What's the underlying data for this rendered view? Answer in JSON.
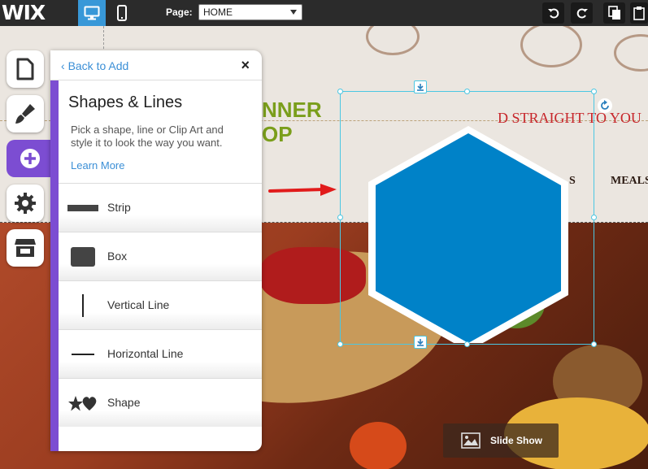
{
  "topbar": {
    "logo": "WIX",
    "page_label": "Page:",
    "page_select": "HOME"
  },
  "site": {
    "title_line1": "NNER",
    "title_line2": "OP",
    "tagline": "D STRAIGHT TO YOU",
    "nav": [
      "S",
      "MEALS"
    ],
    "slideshow_label": "Slide Show",
    "hexagon_color": "#0082c8"
  },
  "panel": {
    "back_label": "Back to Add",
    "close_label": "×",
    "title": "Shapes & Lines",
    "description": "Pick a shape, line or Clip Art and style it to look the way you want.",
    "learn_more": "Learn More",
    "items": [
      {
        "label": "Strip",
        "icon": "strip-icon"
      },
      {
        "label": "Box",
        "icon": "box-icon"
      },
      {
        "label": "Vertical Line",
        "icon": "vertical-line-icon"
      },
      {
        "label": "Horizontal Line",
        "icon": "horizontal-line-icon"
      },
      {
        "label": "Shape",
        "icon": "star-heart-shape-icon"
      }
    ]
  },
  "colors": {
    "accent_purple": "#7c4dd2",
    "link_blue": "#3b8fd6",
    "topbar": "#2b2b2b",
    "active_device": "#3898d8",
    "selection": "#4bc7e3"
  }
}
